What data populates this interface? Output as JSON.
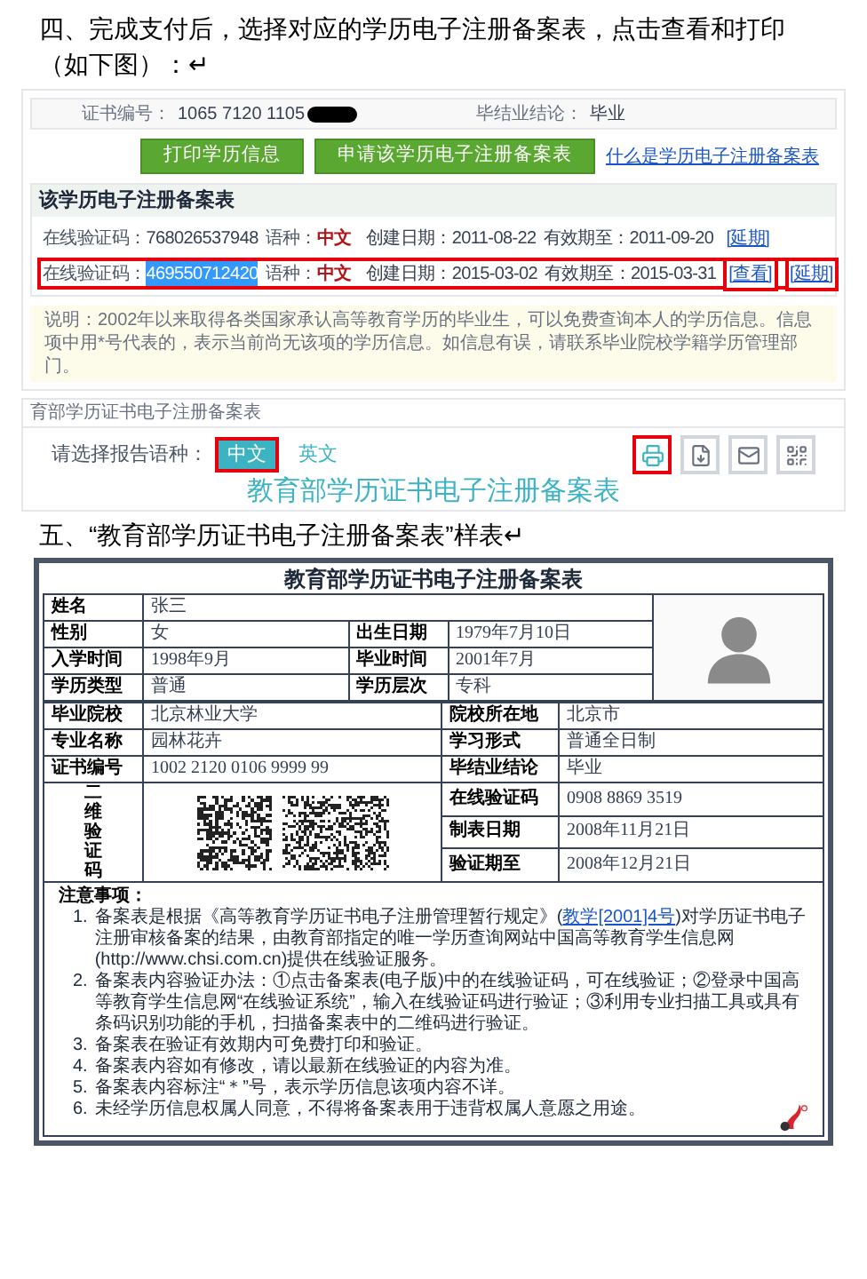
{
  "step4": "四、完成支付后，选择对应的学历电子注册备案表，点击查看和打印（如下图）：↵",
  "screenshot1": {
    "cert_label": "证书编号：",
    "cert_value": "1065 7120 1105",
    "cert_redacted": true,
    "conclusion_label": "毕结业结论：",
    "conclusion_value": "毕业",
    "buttons": [
      "打印学历信息",
      "申请该学历电子注册备案表"
    ],
    "help_link": "什么是学历电子注册备案表",
    "panel_title": "该学历电子注册备案表",
    "records": [
      {
        "code_label": "在线验证码：",
        "code": "768026537948",
        "code_selected": false,
        "lang_label": "语种：",
        "lang": "中文",
        "created": "创建日期：2011-08-22",
        "expires": "有效期至：2011-09-20",
        "annotated": false,
        "actions": [
          {
            "label": "[延期]",
            "annotated": false
          }
        ]
      },
      {
        "code_label": "在线验证码：",
        "code": "469550712420",
        "code_selected": true,
        "lang_label": "语种：",
        "lang": "中文",
        "created": "创建日期：2015-03-02",
        "expires": "有效期至：2015-03-31",
        "annotated": true,
        "actions": [
          {
            "label": "[查看]",
            "annotated": true
          },
          {
            "label": "[延期]",
            "annotated": true
          }
        ]
      }
    ],
    "note": "说明：2002年以来取得各类国家承认高等教育学历的毕业生，可以免费查询本人的学历信息。信息项中用*号代表的，表示当前尚无该项的学历信息。如信息有误，请联系毕业院校学籍学历管理部门。"
  },
  "screenshot2": {
    "breadcrumb": "育部学历证书电子注册备案表",
    "lang_prompt": "请选择报告语种：",
    "languages": [
      {
        "label": "中文",
        "selected": true,
        "annotated": true
      },
      {
        "label": "英文",
        "selected": false,
        "annotated": false
      }
    ],
    "tools": [
      {
        "kind": "print",
        "annotated": true
      },
      {
        "kind": "download",
        "annotated": false
      },
      {
        "kind": "mail",
        "annotated": false
      },
      {
        "kind": "qr",
        "annotated": false
      }
    ],
    "title": "教育部学历证书电子注册备案表"
  },
  "step5": "五、“教育部学历证书电子注册备案表”样表↵",
  "form": {
    "title": "教育部学历证书电子注册备案表",
    "top_rows": [
      [
        {
          "label": "姓名",
          "value": "张三"
        }
      ],
      [
        {
          "label": "性别",
          "value": "女"
        },
        {
          "label": "出生日期",
          "value": "1979年7月10日"
        }
      ],
      [
        {
          "label": "入学时间",
          "value": "1998年9月"
        },
        {
          "label": "毕业时间",
          "value": "2001年7月"
        }
      ],
      [
        {
          "label": "学历类型",
          "value": "普通"
        },
        {
          "label": "学历层次",
          "value": "专科"
        }
      ]
    ],
    "bottom_rows": [
      [
        {
          "label": "毕业院校",
          "value": "北京林业大学"
        },
        {
          "label": "院校所在地",
          "value": "北京市"
        }
      ],
      [
        {
          "label": "专业名称",
          "value": "园林花卉"
        },
        {
          "label": "学习形式",
          "value": "普通全日制"
        }
      ],
      [
        {
          "label": "证书编号",
          "value": "1002 2120 0106 9999 99"
        },
        {
          "label": "毕结业结论",
          "value": "毕业"
        }
      ]
    ],
    "qr_label": "二维验证码",
    "qr_fields": [
      {
        "label": "在线验证码",
        "value": "0908 8869 3519"
      },
      {
        "label": "制表日期",
        "value": "2008年11月21日"
      },
      {
        "label": "验证期至",
        "value": "2008年12月21日"
      }
    ],
    "notes_title": "注意事项：",
    "notes": [
      {
        "number": "1.",
        "text": "备案表是根据《高等教育学历证书电子注册管理暂行规定》(",
        "link": "教学[2001]4号",
        "after": ")对学历证书电子注册审核备案的结果，由教育部指定的唯一学历查询网站中国高等教育学生信息网(http://www.chsi.com.cn)提供在线验证服务。"
      },
      {
        "number": "2.",
        "text": "备案表内容验证办法：①点击备案表(电子版)中的在线验证码，可在线验证；②登录中国高等教育学生信息网“在线验证系统”，输入在线验证码进行验证；③利用专业扫描工具或具有条码识别功能的手机，扫描备案表中的二维码进行验证。"
      },
      {
        "number": "3.",
        "text": "备案表在验证有效期内可免费打印和验证。"
      },
      {
        "number": "4.",
        "text": "备案表内容如有修改，请以最新在线验证的内容为准。"
      },
      {
        "number": "5.",
        "text": "备案表内容标注“＊”号，表示学历信息该项内容不详。"
      },
      {
        "number": "6.",
        "text": "未经学历信息权属人同意，不得将备案表用于违背权属人意愿之用途。"
      }
    ]
  }
}
